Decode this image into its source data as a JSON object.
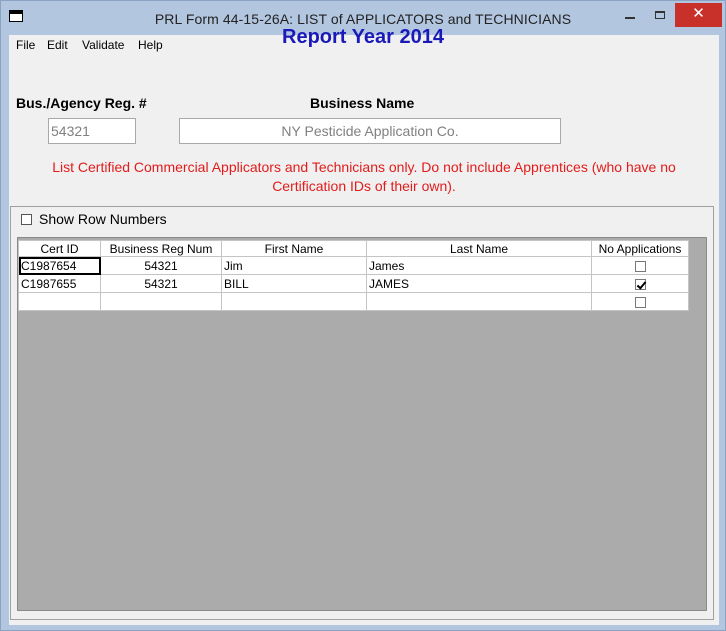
{
  "window": {
    "title": "PRL Form 44-15-26A: LIST of APPLICATORS and TECHNICIANS",
    "icons": {
      "app": "app-window-icon",
      "minimize": "minimize-icon",
      "maximize": "maximize-icon",
      "close": "close-icon"
    },
    "close_glyph": "✕"
  },
  "menu": {
    "items": [
      "File",
      "Edit",
      "Validate",
      "Help"
    ]
  },
  "report": {
    "year_title": "Report Year 2014"
  },
  "business": {
    "reg_label": "Bus./Agency Reg. #",
    "reg_value": "54321",
    "name_label": "Business Name",
    "name_value": "NY Pesticide Application Co."
  },
  "notice": {
    "text": "List Certified Commercial Applicators and Technicians only. Do not include Apprentices (who have no Certification IDs of their own)."
  },
  "options": {
    "show_row_numbers_label": "Show Row Numbers",
    "show_row_numbers_checked": false
  },
  "grid": {
    "columns": [
      "Cert ID",
      "Business Reg Num",
      "First Name",
      "Last Name",
      "No Applications"
    ],
    "rows": [
      {
        "cert_id": "C1987654",
        "reg_num": "54321",
        "first": "Jim",
        "last": "James",
        "no_apps": false
      },
      {
        "cert_id": "C1987655",
        "reg_num": "54321",
        "first": "BILL",
        "last": "JAMES",
        "no_apps": true
      },
      {
        "cert_id": "",
        "reg_num": "",
        "first": "",
        "last": "",
        "no_apps": false
      }
    ]
  },
  "colors": {
    "title_blue": "#1a1ab8",
    "notice_red": "#e21c1c",
    "close_red": "#c7312a",
    "frame": "#b3c6e0",
    "grid_empty": "#ababab"
  }
}
